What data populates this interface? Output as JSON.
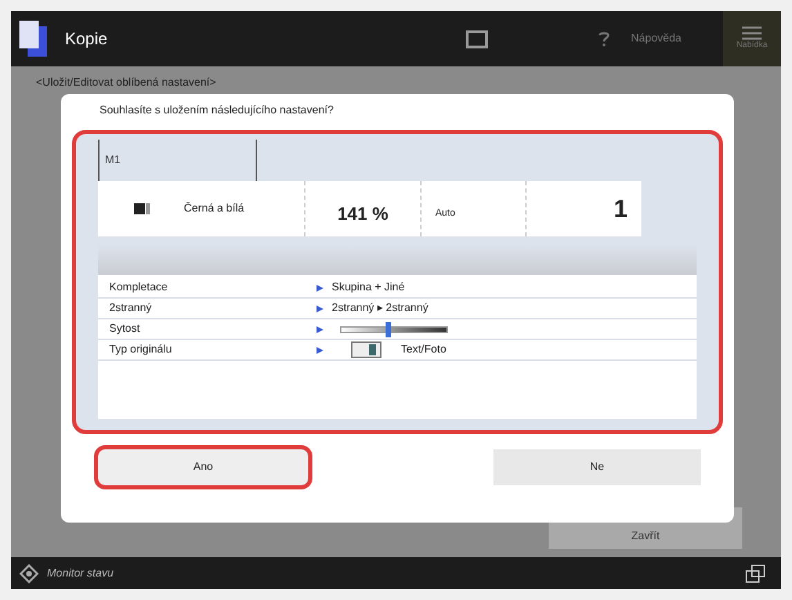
{
  "header": {
    "title": "Kopie",
    "help": "Nápověda",
    "menu": "Nabídka"
  },
  "subtitle": "<Uložit/Editovat oblíbená nastavení>",
  "background_button": "Zavřít",
  "dialog": {
    "question": "Souhlasíte s uložením následujícího nastavení?",
    "tab": "M1",
    "summary": {
      "color_mode": "Černá a bílá",
      "zoom": "141 %",
      "paper": "Auto",
      "copies": "1"
    },
    "settings": [
      {
        "kind": "text",
        "label": "Kompletace",
        "value": "Skupina + Jiné"
      },
      {
        "kind": "text",
        "label": "2stranný",
        "value": "2stranný ▸ 2stranný"
      },
      {
        "kind": "slider",
        "label": "Sytost",
        "level": 0.45
      },
      {
        "kind": "original",
        "label": "Typ originálu",
        "value": "Text/Foto"
      }
    ],
    "buttons": [
      {
        "label": "Ano",
        "highlighted": true
      },
      {
        "label": "Ne",
        "highlighted": false
      }
    ]
  },
  "footer": {
    "status": "Monitor stavu"
  }
}
